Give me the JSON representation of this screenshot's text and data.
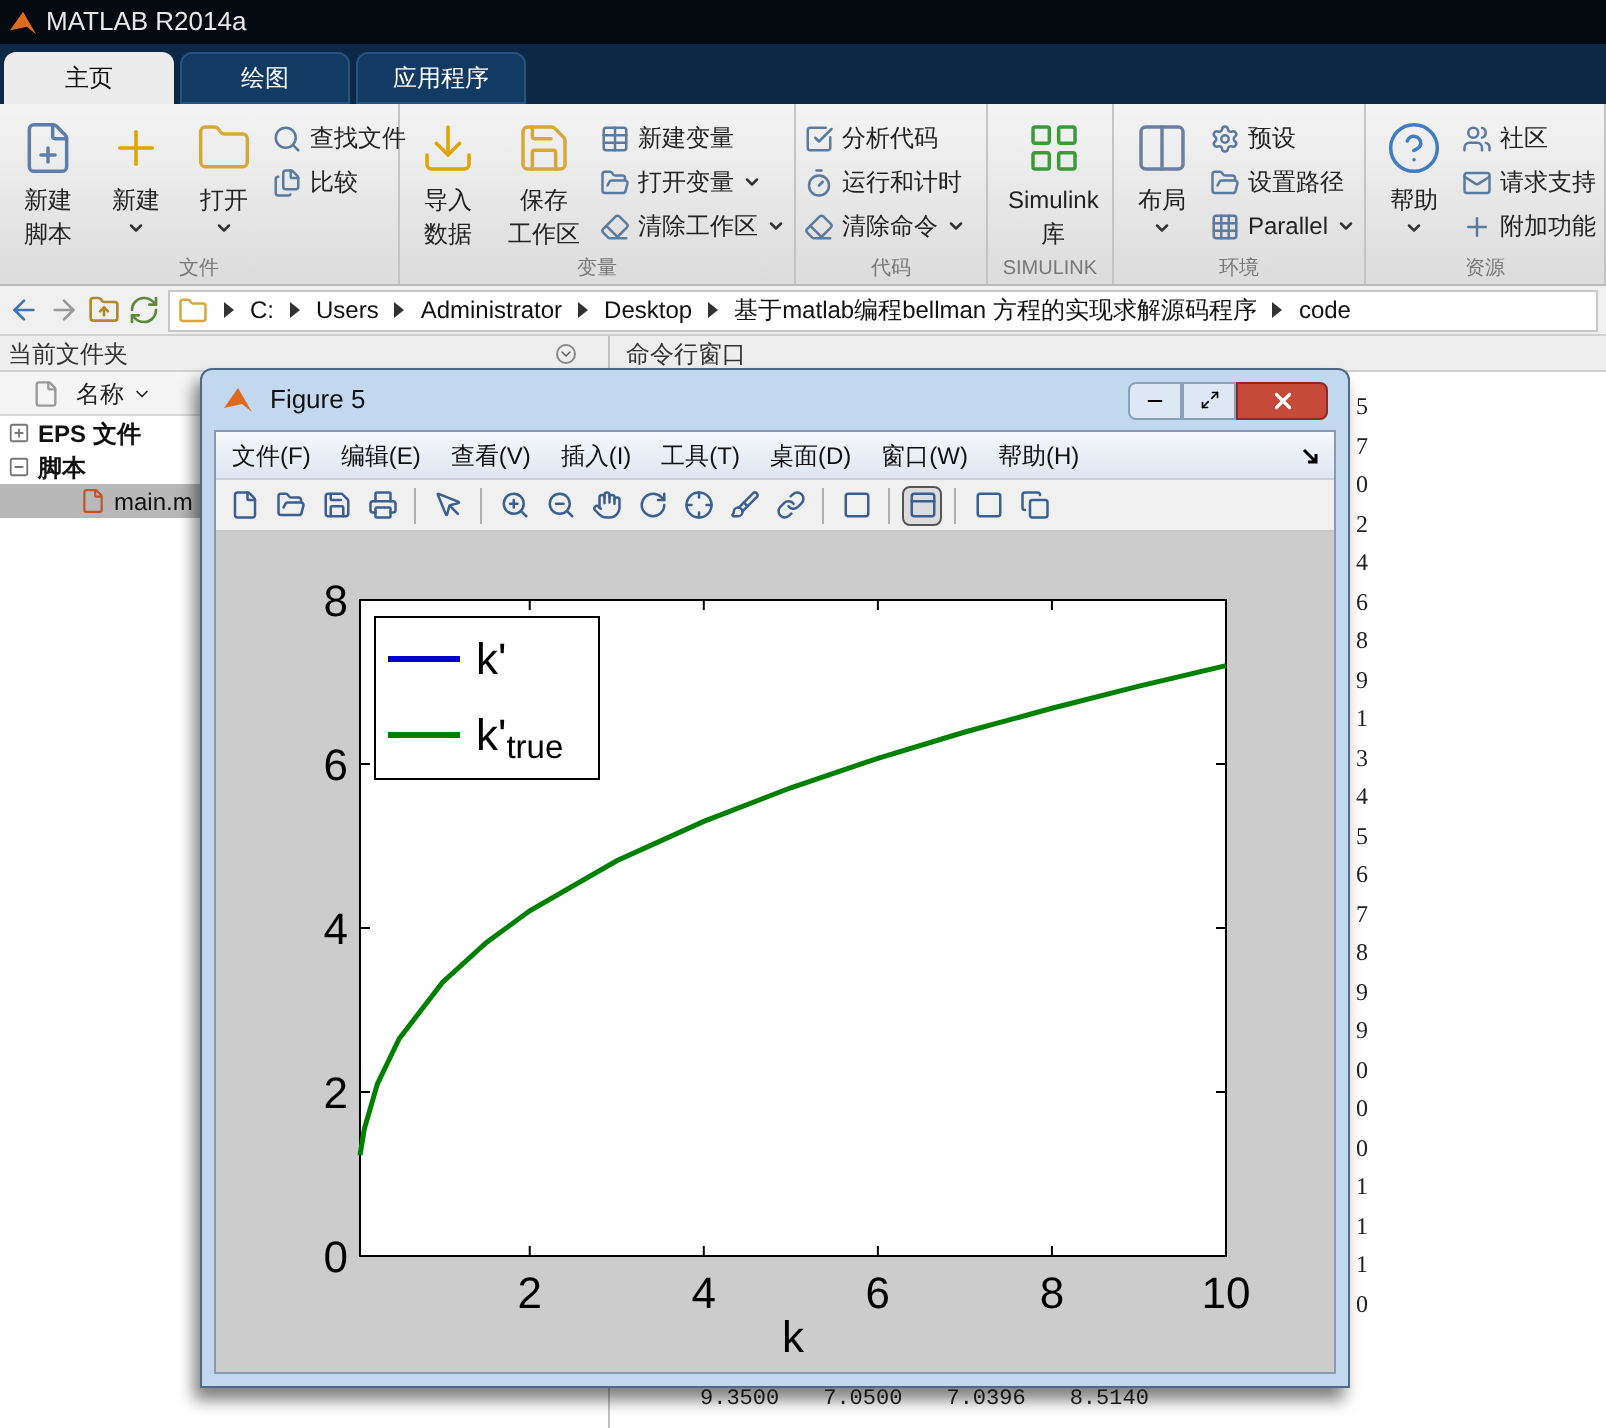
{
  "window": {
    "title": "MATLAB R2014a"
  },
  "tabs": [
    {
      "label": "主页",
      "selected": true
    },
    {
      "label": "绘图",
      "selected": false
    },
    {
      "label": "应用程序",
      "selected": false
    }
  ],
  "ribbon": {
    "sections": [
      {
        "label": "文件",
        "items": [
          {
            "kind": "large",
            "lines": [
              "新建",
              "脚本"
            ],
            "dropdown": false
          },
          {
            "kind": "large",
            "lines": [
              "新建"
            ],
            "dropdown": true
          },
          {
            "kind": "large",
            "lines": [
              "打开"
            ],
            "dropdown": true
          },
          {
            "kind": "small",
            "label": "查找文件",
            "dropdown": false
          },
          {
            "kind": "small",
            "label": "比较",
            "dropdown": false
          }
        ]
      },
      {
        "label": "变量",
        "items": [
          {
            "kind": "large",
            "lines": [
              "导入",
              "数据"
            ],
            "dropdown": false
          },
          {
            "kind": "large",
            "lines": [
              "保存",
              "工作区"
            ],
            "dropdown": false
          },
          {
            "kind": "small",
            "label": "新建变量",
            "dropdown": false
          },
          {
            "kind": "small",
            "label": "打开变量",
            "dropdown": true
          },
          {
            "kind": "small",
            "label": "清除工作区",
            "dropdown": true
          }
        ]
      },
      {
        "label": "代码",
        "items": [
          {
            "kind": "small",
            "label": "分析代码",
            "dropdown": false
          },
          {
            "kind": "small",
            "label": "运行和计时",
            "dropdown": false
          },
          {
            "kind": "small",
            "label": "清除命令",
            "dropdown": true
          }
        ]
      },
      {
        "label": "SIMULINK",
        "items": [
          {
            "kind": "large",
            "lines": [
              "Simulink",
              "库"
            ],
            "dropdown": false
          }
        ]
      },
      {
        "label": "环境",
        "items": [
          {
            "kind": "large",
            "lines": [
              "布局"
            ],
            "dropdown": true
          },
          {
            "kind": "small",
            "label": "预设",
            "dropdown": false
          },
          {
            "kind": "small",
            "label": "设置路径",
            "dropdown": false
          },
          {
            "kind": "small",
            "label": "Parallel",
            "dropdown": true
          }
        ]
      },
      {
        "label": "资源",
        "items": [
          {
            "kind": "large",
            "lines": [
              "帮助"
            ],
            "dropdown": true
          },
          {
            "kind": "small",
            "label": "社区",
            "dropdown": false
          },
          {
            "kind": "small",
            "label": "请求支持",
            "dropdown": false
          },
          {
            "kind": "small",
            "label": "附加功能",
            "dropdown": false
          }
        ]
      }
    ]
  },
  "address_bar": {
    "segments": [
      "C:",
      "Users",
      "Administrator",
      "Desktop",
      "基于matlab编程bellman 方程的实现求解源码程序",
      "code"
    ]
  },
  "current_folder": {
    "title": "当前文件夹",
    "column": "名称",
    "tree": [
      {
        "label": "EPS 文件",
        "expanded": false,
        "selected": false
      },
      {
        "label": "脚本",
        "expanded": true,
        "selected": false,
        "children": [
          {
            "label": "main.m",
            "selected": true
          }
        ]
      }
    ]
  },
  "command_window": {
    "title": "命令行窗口",
    "column_digits": [
      "5",
      "7",
      "0",
      "2",
      "4",
      "6",
      "8",
      "9",
      "1",
      "3",
      "4",
      "5",
      "6",
      "7",
      "8",
      "9",
      "9",
      "0",
      "0",
      "0",
      "1",
      "1",
      "1",
      "0"
    ],
    "bottom_row": [
      "9.3500",
      "7.0500",
      "7.0396",
      "8.5140"
    ]
  },
  "figure": {
    "title": "Figure 5",
    "menu": [
      "文件(F)",
      "编辑(E)",
      "查看(V)",
      "插入(I)",
      "工具(T)",
      "桌面(D)",
      "窗口(W)",
      "帮助(H)"
    ],
    "toolbar": [
      {
        "selected": false
      },
      {
        "selected": false
      },
      {
        "selected": false
      },
      {
        "selected": false
      },
      {
        "selected": false
      },
      {
        "selected": false
      },
      {
        "selected": false
      },
      {
        "selected": false
      },
      {
        "selected": false
      },
      {
        "selected": false
      },
      {
        "selected": false
      },
      {
        "selected": false
      },
      {
        "selected": false
      },
      {
        "selected": true
      },
      {
        "selected": false
      },
      {
        "selected": false
      }
    ],
    "chart_data": {
      "type": "line",
      "xlabel": "k",
      "x": [
        0.05,
        0.1,
        0.25,
        0.5,
        1,
        1.5,
        2,
        3,
        4,
        5,
        6,
        7,
        8,
        9,
        10
      ],
      "series": [
        {
          "name": "k'",
          "color": "#0000cc",
          "values": [
            null,
            null,
            null,
            null,
            null,
            null,
            null,
            null,
            null,
            null,
            null,
            null,
            null,
            null,
            null
          ]
        },
        {
          "name": "k'$_{true}$",
          "color": "#008000",
          "values": [
            1.23,
            1.55,
            2.1,
            2.65,
            3.34,
            3.82,
            4.21,
            4.82,
            5.3,
            5.71,
            6.07,
            6.39,
            6.68,
            6.95,
            7.2
          ]
        }
      ],
      "xlim": [
        0.05,
        10
      ],
      "ylim": [
        0,
        8
      ],
      "xticks": [
        2,
        4,
        6,
        8,
        10
      ],
      "yticks": [
        0,
        2,
        4,
        6,
        8
      ]
    }
  }
}
